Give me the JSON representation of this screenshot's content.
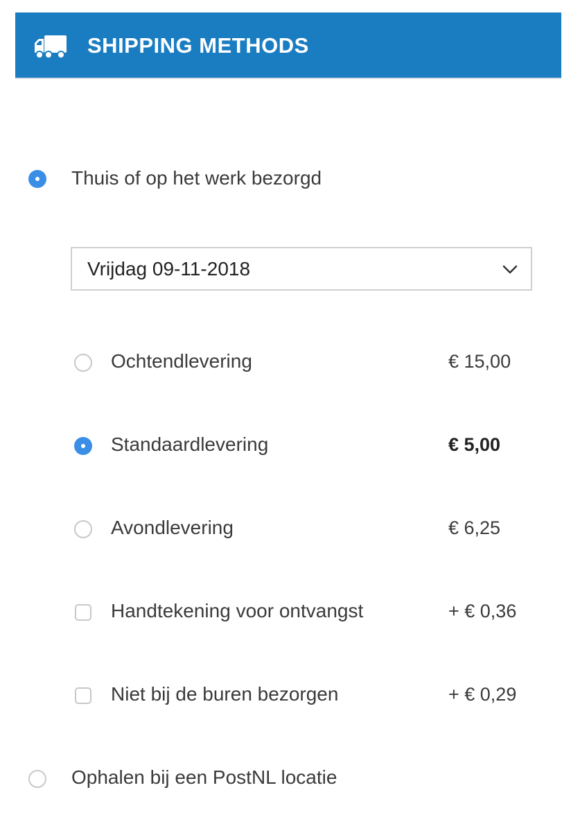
{
  "header": {
    "title": "SHIPPING METHODS",
    "icon": "truck-icon"
  },
  "methods": {
    "home_delivery": {
      "label": "Thuis of op het werk bezorgd",
      "selected": true
    },
    "pickup": {
      "label": "Ophalen bij een PostNL locatie",
      "selected": false
    }
  },
  "date_select": {
    "value": "Vrijdag 09-11-2018"
  },
  "delivery_options": [
    {
      "label": "Ochtendlevering",
      "price": "€ 15,00",
      "selected": false
    },
    {
      "label": "Standaardlevering",
      "price": "€ 5,00",
      "selected": true
    },
    {
      "label": "Avondlevering",
      "price": "€ 6,25",
      "selected": false
    }
  ],
  "extras": [
    {
      "label": "Handtekening voor ontvangst",
      "price": "+ € 0,36",
      "checked": false
    },
    {
      "label": "Niet bij de buren bezorgen",
      "price": "+ € 0,29",
      "checked": false
    }
  ],
  "colors": {
    "header_bg": "#1a7dc1",
    "accent": "#3b8ee6"
  }
}
